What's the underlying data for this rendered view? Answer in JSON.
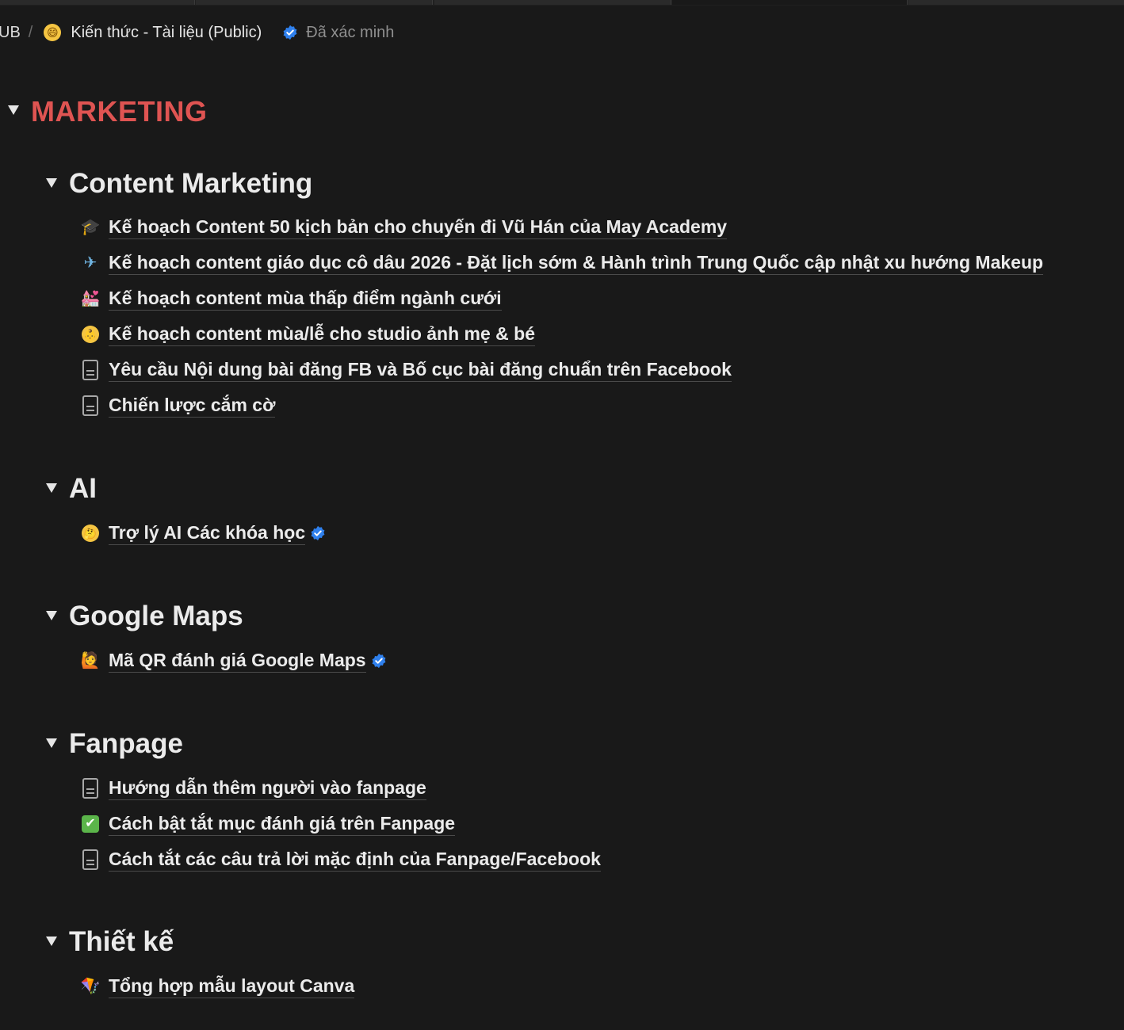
{
  "breadcrumb": {
    "root": "UB",
    "separator": "/",
    "page_emoji": "😄",
    "page_title": "Kiến thức - Tài liệu (Public)",
    "verified_label": "Đã xác minh"
  },
  "heading": "MARKETING",
  "sections": [
    {
      "title": "Content Marketing",
      "items": [
        {
          "icon": "graduation-cap-icon",
          "glyph": "🎓",
          "label": "Kế hoạch Content 50 kịch bản cho chuyến đi Vũ Hán của May Academy"
        },
        {
          "icon": "airplane-icon",
          "glyph": "✈",
          "label": "Kế hoạch content giáo dục cô dâu 2026 - Đặt lịch sớm & Hành trình Trung Quốc cập nhật xu hướng Makeup"
        },
        {
          "icon": "wedding-icon",
          "glyph": "💒",
          "label": "Kế hoạch content mùa thấp điểm ngành cưới"
        },
        {
          "icon": "baby-face-icon",
          "glyph": "👶",
          "label": "Kế hoạch content mùa/lễ cho studio ảnh mẹ & bé"
        },
        {
          "icon": "document-icon",
          "glyph": "",
          "label": "Yêu cầu Nội dung bài đăng FB và Bố cục bài đăng chuẩn trên Facebook"
        },
        {
          "icon": "document-icon",
          "glyph": "",
          "label": "Chiến lược cắm cờ"
        }
      ]
    },
    {
      "title": "AI",
      "items": [
        {
          "icon": "thinking-face-icon",
          "glyph": "🤔",
          "label": "Trợ lý AI Các khóa học",
          "verified": true
        }
      ]
    },
    {
      "title": "Google Maps",
      "items": [
        {
          "icon": "person-icon",
          "glyph": "🙋",
          "label": "Mã QR đánh giá Google Maps",
          "verified": true
        }
      ]
    },
    {
      "title": "Fanpage",
      "items": [
        {
          "icon": "document-icon",
          "glyph": "",
          "label": "Hướng dẫn thêm người vào fanpage"
        },
        {
          "icon": "check-mark-icon",
          "glyph": "✔",
          "label": "Cách bật tắt mục đánh giá trên Fanpage"
        },
        {
          "icon": "document-icon",
          "glyph": "",
          "label": "Cách tắt các câu trả lời mặc định của Fanpage/Facebook"
        }
      ]
    },
    {
      "title": "Thiết kế",
      "items": [
        {
          "icon": "kite-icon",
          "glyph": "🪁",
          "label": "Tổng hợp mẫu layout Canva"
        }
      ]
    }
  ],
  "colors": {
    "background": "#191919",
    "heading_red": "#df5452",
    "verified_blue": "#2f80ed"
  }
}
